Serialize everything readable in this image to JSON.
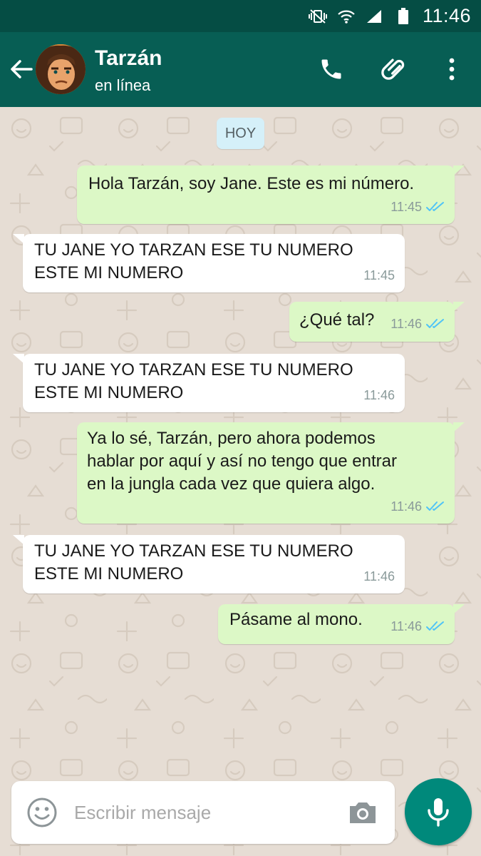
{
  "status_bar": {
    "time": "11:46",
    "icons": [
      "mute-vibrate-icon",
      "wifi-icon",
      "signal-icon",
      "battery-icon"
    ]
  },
  "header": {
    "contact_name": "Tarzán",
    "contact_status": "en línea",
    "icons": [
      "back-arrow-icon",
      "phone-icon",
      "attach-icon",
      "more-vert-icon"
    ],
    "color": "#075e54"
  },
  "chat": {
    "day_label": "HOY",
    "messages": [
      {
        "direction": "out",
        "text": "Hola Tarzán, soy Jane. Este es mi número.",
        "time": "11:45",
        "status": "read"
      },
      {
        "direction": "in",
        "text": "TU JANE YO TARZAN ESE TU NUMERO\nESTE MI NUMERO",
        "time": "11:45"
      },
      {
        "direction": "out",
        "text": "¿Qué tal?",
        "time": "11:46",
        "status": "read"
      },
      {
        "direction": "in",
        "text": "TU JANE YO TARZAN ESE TU NUMERO\nESTE MI NUMERO",
        "time": "11:46"
      },
      {
        "direction": "out",
        "text": "Ya lo sé, Tarzán, pero ahora podemos\nhablar por aquí y así no tengo que entrar\nen la jungla cada vez que quiera algo.",
        "time": "11:46",
        "status": "read"
      },
      {
        "direction": "in",
        "text": "TU JANE YO TARZAN ESE TU NUMERO\nESTE MI NUMERO",
        "time": "11:46"
      },
      {
        "direction": "out",
        "text": "Pásame al mono.",
        "time": "11:46",
        "status": "read"
      }
    ]
  },
  "composer": {
    "placeholder": "Escribir mensaje",
    "icons": [
      "emoji-icon",
      "camera-icon",
      "mic-icon"
    ]
  },
  "colors": {
    "outgoing_bubble": "#dcf8c6",
    "incoming_bubble": "#ffffff",
    "read_ticks": "#4fc3f7",
    "accent": "#00897b"
  }
}
